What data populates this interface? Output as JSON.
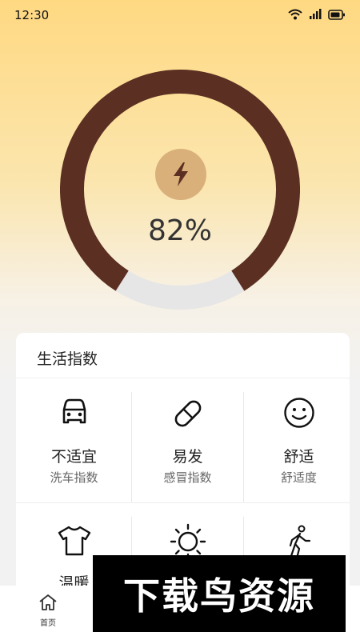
{
  "status_bar": {
    "time": "12:30",
    "icons": [
      "wifi-icon",
      "signal-icon",
      "battery-icon"
    ]
  },
  "battery": {
    "percent_text": "82%",
    "level": 0.82,
    "icon": "lightning-icon",
    "colors": {
      "filled": "#5b2f22",
      "empty": "#e6e6e6"
    }
  },
  "life_index": {
    "title": "生活指数",
    "items": [
      {
        "icon": "car-icon",
        "value": "不适宜",
        "label": "洗车指数"
      },
      {
        "icon": "pill-icon",
        "value": "易发",
        "label": "感冒指数"
      },
      {
        "icon": "smile-icon",
        "value": "舒适",
        "label": "舒适度"
      },
      {
        "icon": "tshirt-icon",
        "value": "温暖",
        "label": ""
      },
      {
        "icon": "sun-icon",
        "value": "",
        "label": ""
      },
      {
        "icon": "walking-icon",
        "value": "",
        "label": ""
      }
    ]
  },
  "tab_bar": {
    "home_label": "首页",
    "home_icon": "home-icon"
  },
  "watermark": {
    "text": "下载鸟资源"
  }
}
